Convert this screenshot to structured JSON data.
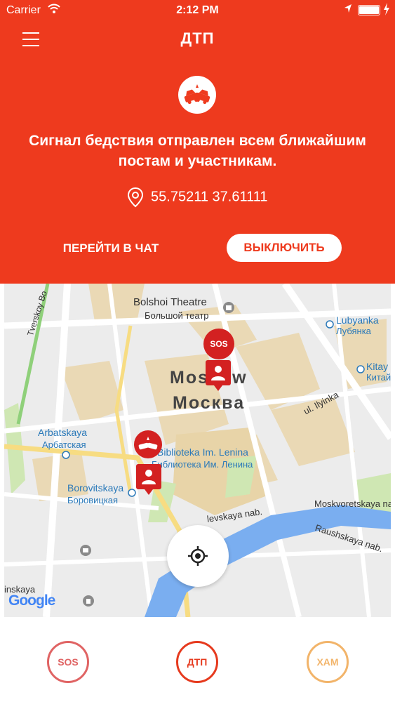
{
  "status_bar": {
    "carrier": "Carrier",
    "time": "2:12 PM"
  },
  "header": {
    "title": "ДТП",
    "message": "Сигнал бедствия отправлен всем ближайшим постам и участникам.",
    "coordinates": "55.75211 37.61111",
    "chat_button": "ПЕРЕЙТИ В ЧАТ",
    "off_button": "ВЫКЛЮЧИТЬ"
  },
  "map": {
    "labels": {
      "tverskoy": "Tverskoy Bo",
      "bolshoi_en": "Bolshoi Theatre",
      "bolshoi_ru": "Большой театр",
      "lubyanka_en": "Lubyanka",
      "lubyanka_ru": "Лубянка",
      "kitay_en": "Kitay",
      "kitay_ru": "Китай",
      "moscow_en": "Moscow",
      "moscow_ru": "Москва",
      "ilyinka": "ul. Ilyinka",
      "arbatskaya_en": "Arbatskaya",
      "arbatskaya_ru": "Арбатская",
      "lenina_en": "Biblioteka Im. Lenina",
      "lenina_ru": "Библиотека Им. Ленина",
      "borovitskaya_en": "Borovitskaya",
      "borovitskaya_ru": "Боровицкая",
      "moskvoretskaya": "Moskvoretskaya nab.",
      "sofiyskaya": "levskaya nab.",
      "raushskaya": "Raushskaya nab.",
      "kropotkinskaya": "inskaya"
    },
    "sos_marker": "SOS",
    "attribution": "Google"
  },
  "tabs": [
    {
      "label": "SOS",
      "color": "#e06464"
    },
    {
      "label": "ДТП",
      "color": "#e63a1e"
    },
    {
      "label": "ХАМ",
      "color": "#f2b46a"
    }
  ],
  "colors": {
    "accent": "#ee3a1e",
    "marker": "#d32121"
  }
}
